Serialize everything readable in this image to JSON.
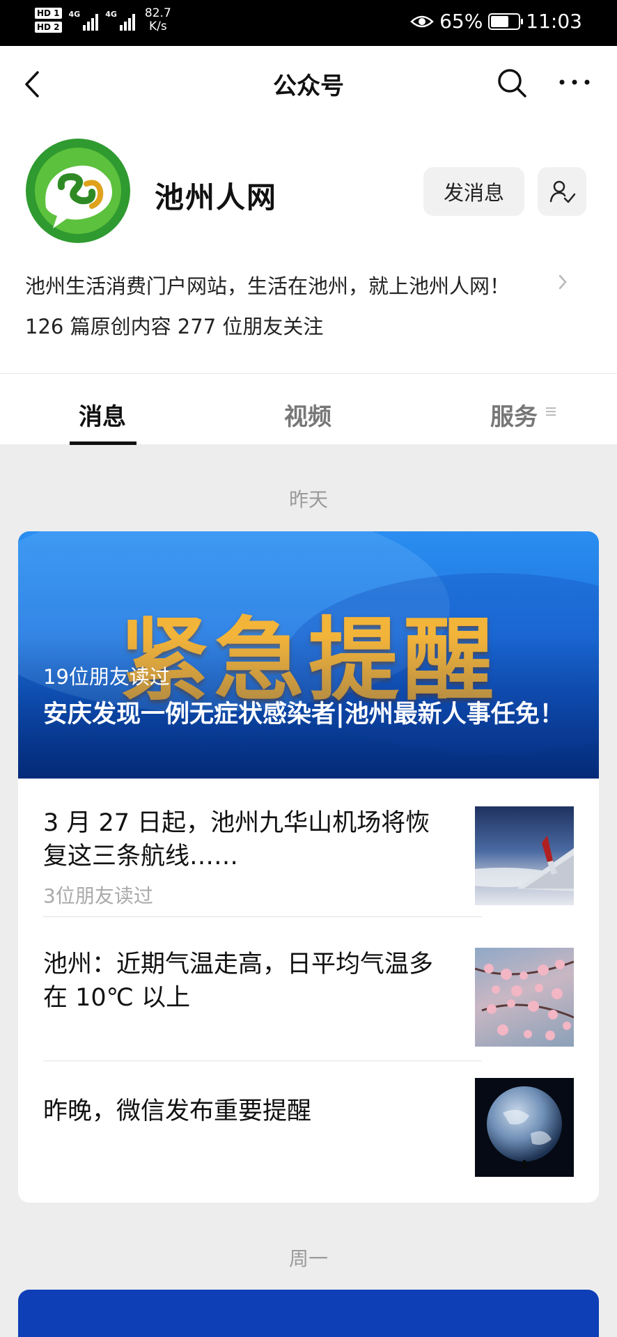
{
  "status_bar": {
    "hd1": "HD 1",
    "hd2": "HD 2",
    "net1": "4G",
    "net2": "4G",
    "speed_value": "82.7",
    "speed_unit": "K/s",
    "battery": "65%",
    "battery_level": 0.65,
    "time": "11:03"
  },
  "navbar": {
    "title": "公众号"
  },
  "profile": {
    "name": "池州人网",
    "send_message_label": "发消息",
    "description": "池州生活消费门户网站，生活在池州，就上池州人网！",
    "stats": "126 篇原创内容  277 位朋友关注"
  },
  "tabs": [
    {
      "label": "消息",
      "active": true
    },
    {
      "label": "视频",
      "active": false
    },
    {
      "label": "服务",
      "active": false
    }
  ],
  "feed": [
    {
      "date": "昨天",
      "featured": {
        "banner_text": "紧急提醒",
        "reads": "19位朋友读过",
        "title": "安庆发现一例无症状感染者|池州最新人事任免！"
      },
      "items": [
        {
          "title": "3 月 27 日起，池州九华山机场将恢复这三条航线……",
          "reads": "3位朋友读过",
          "thumb_icon": "airplane-wing-photo"
        },
        {
          "title": "池州：近期气温走高，日平均气温多在 10℃ 以上",
          "reads": "",
          "thumb_icon": "plum-blossom-photo"
        },
        {
          "title": "昨晚，微信发布重要提醒",
          "reads": "",
          "thumb_icon": "earth-photo"
        }
      ]
    },
    {
      "date": "周一"
    }
  ],
  "colors": {
    "accent_blue": "#1e74de",
    "banner_text_gold": "#f3b43a",
    "background": "#ededed"
  }
}
